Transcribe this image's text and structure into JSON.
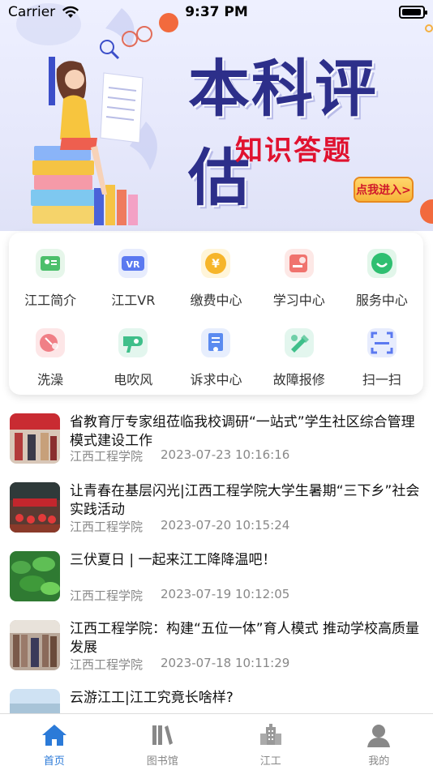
{
  "status_bar": {
    "carrier": "Carrier",
    "time": "9:37 PM",
    "battery_level": 0.95
  },
  "banner": {
    "title": "本科评估",
    "subtitle": "知识答题",
    "button_label": "点我进入>"
  },
  "quick_menu": {
    "items": [
      {
        "label": "江工简介",
        "icon": "id-card-icon",
        "color": "#4cbf6b",
        "bg": "#e6f6ea"
      },
      {
        "label": "江工VR",
        "icon": "vr-icon",
        "color": "#5b79f0",
        "bg": "#e7ecfd"
      },
      {
        "label": "缴费中心",
        "icon": "yen-coin-icon",
        "color": "#f6b52a",
        "bg": "#fff5d9"
      },
      {
        "label": "学习中心",
        "icon": "study-icon",
        "color": "#f0736e",
        "bg": "#fde8e6"
      },
      {
        "label": "服务中心",
        "icon": "service-chat-icon",
        "color": "#2fbf71",
        "bg": "#e2f6ea"
      },
      {
        "label": "洗澡",
        "icon": "shower-icon",
        "color": "#f07f86",
        "bg": "#fde6e7"
      },
      {
        "label": "电吹风",
        "icon": "hair-dryer-icon",
        "color": "#3fbf8a",
        "bg": "#e3f6ee"
      },
      {
        "label": "诉求中心",
        "icon": "complaint-icon",
        "color": "#5b8bf0",
        "bg": "#e7eefd"
      },
      {
        "label": "故障报修",
        "icon": "repair-tools-icon",
        "color": "#3fbf8a",
        "bg": "#e3f6ee"
      },
      {
        "label": "扫一扫",
        "icon": "scan-icon",
        "color": "#5b79f0",
        "bg": "#e7ecfd"
      }
    ]
  },
  "news": [
    {
      "title": "省教育厅专家组莅临我校调研“一站式”学生社区综合管理模式建设工作",
      "source": "江西工程学院",
      "time": "2023-07-23 10:16:16"
    },
    {
      "title": "让青春在基层闪光|江西工程学院大学生暑期“三下乡”社会实践活动",
      "source": "江西工程学院",
      "time": "2023-07-20 10:15:24"
    },
    {
      "title": "三伏夏日 | 一起来江工降降温吧！",
      "source": "江西工程学院",
      "time": "2023-07-19 10:12:05"
    },
    {
      "title": "江西工程学院：构建“五位一体”育人模式 推动学校高质量发展",
      "source": "江西工程学院",
      "time": "2023-07-18 10:11:29"
    },
    {
      "title": "云游江工|江工究竟长啥样?",
      "source": "",
      "time": ""
    }
  ],
  "tab_bar": {
    "tabs": [
      {
        "label": "首页",
        "icon": "home-icon",
        "active": true
      },
      {
        "label": "图书馆",
        "icon": "books-icon",
        "active": false
      },
      {
        "label": "江工",
        "icon": "campus-building-icon",
        "active": false
      },
      {
        "label": "我的",
        "icon": "user-icon",
        "active": false
      }
    ],
    "active_color": "#2b7ad8",
    "inactive_color": "#888888"
  }
}
